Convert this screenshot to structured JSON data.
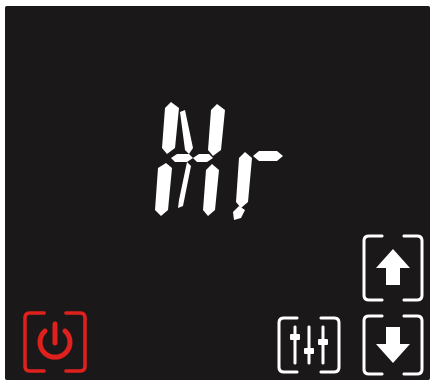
{
  "display": {
    "readout": "Hr",
    "segment_color": "#ffffff",
    "background_color": "#1a1819"
  },
  "controls": {
    "power": {
      "icon": "power-icon",
      "color": "#e0201c"
    },
    "settings": {
      "icon": "sliders-icon",
      "color": "#ffffff"
    },
    "up": {
      "icon": "arrow-up-icon",
      "color": "#ffffff"
    },
    "down": {
      "icon": "arrow-down-icon",
      "color": "#ffffff"
    }
  }
}
